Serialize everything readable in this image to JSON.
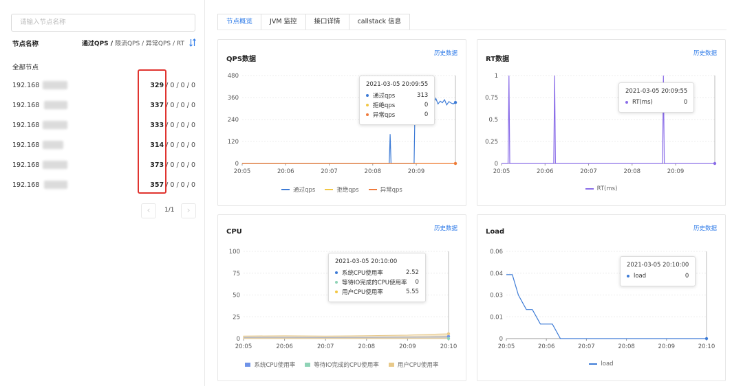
{
  "sidebar": {
    "search_placeholder": "请输入节点名称",
    "node_col_label": "节点名称",
    "metric_col_label_bold": "通过QPS /",
    "metric_col_label_rest": " 限流QPS / 异常QPS / RT",
    "all_nodes": "全部节点",
    "nodes": [
      {
        "ip": "192.168",
        "metric": "329",
        "rest": " / 0 / 0 / 0"
      },
      {
        "ip": "192.168",
        "metric": "337",
        "rest": " / 0 / 0 / 0"
      },
      {
        "ip": "192.168",
        "metric": "333",
        "rest": " / 0 / 0 / 0"
      },
      {
        "ip": "192.168",
        "metric": "314",
        "rest": " / 0 / 0 / 0"
      },
      {
        "ip": "192.168",
        "metric": "373",
        "rest": " / 0 / 0 / 0"
      },
      {
        "ip": "192.168",
        "metric": "357",
        "rest": " / 0 / 0 / 0"
      }
    ],
    "pager": {
      "text": "1/1",
      "prev": "‹",
      "next": "›"
    }
  },
  "tabs": [
    "节点概览",
    "JVM 监控",
    "接口详情",
    "callstack 信息"
  ],
  "history_link": "历史数据",
  "colors": {
    "accent": "#2f7be8",
    "highlight": "#e0342f"
  },
  "chart_data": [
    {
      "type": "line",
      "title": "QPS数据",
      "x_ticks": [
        "20:05",
        "20:06",
        "20:07",
        "20:08",
        "20:09"
      ],
      "y_ticks": [
        "480",
        "360",
        "240",
        "120",
        "0"
      ],
      "ylim": [
        0,
        480
      ],
      "xlim": [
        0,
        4.9
      ],
      "grid": true,
      "legend_placement": "bottom",
      "series": [
        {
          "name": "通过qps",
          "color": "#3d7bd6",
          "x": [
            0,
            3.38,
            3.4,
            3.42,
            3.44,
            3.46,
            3.48,
            3.5,
            3.95,
            3.98,
            4.0,
            4.05,
            4.1,
            4.15,
            4.2,
            4.25,
            4.3,
            4.35,
            4.4,
            4.45,
            4.5,
            4.55,
            4.6,
            4.65,
            4.7,
            4.75,
            4.8,
            4.85,
            4.9
          ],
          "y": [
            0,
            0,
            160,
            0,
            0,
            0,
            0,
            0,
            0,
            440,
            340,
            345,
            322,
            338,
            330,
            350,
            318,
            342,
            335,
            355,
            325,
            340,
            332,
            348,
            320,
            338,
            330,
            325,
            333
          ]
        },
        {
          "name": "拒绝qps",
          "color": "#f2c744",
          "x": [
            0,
            4.9
          ],
          "y": [
            0,
            0
          ]
        },
        {
          "name": "异常qps",
          "color": "#ef7a3c",
          "x": [
            0,
            4.9
          ],
          "y": [
            0,
            0
          ]
        }
      ],
      "tooltip": {
        "time": "2021-03-05 20:09:55",
        "rows": [
          {
            "name": "通过qps",
            "value": "313",
            "color": "#3d7bd6"
          },
          {
            "name": "拒绝qps",
            "value": "0",
            "color": "#f2c744"
          },
          {
            "name": "异常qps",
            "value": "0",
            "color": "#ef7a3c"
          }
        ]
      }
    },
    {
      "type": "line",
      "title": "RT数据",
      "x_ticks": [
        "20:05",
        "20:06",
        "20:07",
        "20:08",
        "20:09"
      ],
      "y_ticks": [
        "1",
        "0.75",
        "0.5",
        "0.25",
        "0"
      ],
      "ylim": [
        0,
        1
      ],
      "xlim": [
        0,
        4.9
      ],
      "grid": true,
      "legend_placement": "bottom",
      "series": [
        {
          "name": "RT(ms)",
          "color": "#8a6de8",
          "x": [
            0,
            0.15,
            0.17,
            0.19,
            1.2,
            1.22,
            1.24,
            3.7,
            3.72,
            3.74,
            4.9
          ],
          "y": [
            0,
            0,
            1,
            0,
            0,
            1,
            0,
            0,
            1,
            0,
            0
          ]
        }
      ],
      "tooltip": {
        "time": "2021-03-05 20:09:55",
        "rows": [
          {
            "name": "RT(ms)",
            "value": "0",
            "color": "#8a6de8"
          }
        ]
      }
    },
    {
      "type": "area",
      "title": "CPU",
      "x_ticks": [
        "20:05",
        "20:06",
        "20:07",
        "20:08",
        "20:09",
        "20:10"
      ],
      "y_ticks": [
        "100",
        "75",
        "50",
        "25",
        "0"
      ],
      "ylim": [
        0,
        100
      ],
      "xlim": [
        0,
        5
      ],
      "grid": true,
      "legend_placement": "bottom",
      "series": [
        {
          "name": "系统CPU使用率",
          "color": "#6f93e8",
          "x": [
            0,
            1,
            2,
            3,
            4,
            4.5,
            5
          ],
          "y": [
            1.5,
            1.6,
            1.4,
            1.5,
            1.7,
            2.0,
            2.52
          ]
        },
        {
          "name": "等待IO完成的CPU使用率",
          "color": "#8fd3b6",
          "x": [
            0,
            5
          ],
          "y": [
            0,
            0
          ]
        },
        {
          "name": "用户CPU使用率",
          "color": "#e8c98a",
          "x": [
            0,
            1,
            2,
            3,
            4,
            4.5,
            5
          ],
          "y": [
            3.0,
            3.2,
            2.9,
            3.3,
            4.0,
            5.0,
            5.55
          ]
        }
      ],
      "tooltip": {
        "time": "2021-03-05 20:10:00",
        "rows": [
          {
            "name": "系统CPU使用率",
            "value": "2.52",
            "color": "#3d7bd6"
          },
          {
            "name": "等待IO完成的CPU使用率",
            "value": "0",
            "color": "#8fd3b6"
          },
          {
            "name": "用户CPU使用率",
            "value": "5.55",
            "color": "#f2c744"
          }
        ]
      }
    },
    {
      "type": "line",
      "title": "Load",
      "x_ticks": [
        "20:05",
        "20:06",
        "20:07",
        "20:08",
        "20:09",
        "20:10"
      ],
      "y_ticks": [
        "0.06",
        "0.04",
        "0.03",
        "0.01",
        "0"
      ],
      "ylim": [
        0,
        0.06
      ],
      "xlim": [
        0,
        5
      ],
      "grid": true,
      "legend_placement": "bottom",
      "series": [
        {
          "name": "load",
          "color": "#3d7bd6",
          "x": [
            0,
            0.15,
            0.3,
            0.5,
            0.65,
            0.75,
            0.85,
            1.0,
            1.15,
            1.35,
            5
          ],
          "y": [
            0.044,
            0.044,
            0.03,
            0.02,
            0.02,
            0.015,
            0.01,
            0.01,
            0.01,
            0.0,
            0.0
          ]
        }
      ],
      "tooltip": {
        "time": "2021-03-05 20:10:00",
        "rows": [
          {
            "name": "load",
            "value": "0",
            "color": "#3d7bd6"
          }
        ]
      }
    }
  ]
}
